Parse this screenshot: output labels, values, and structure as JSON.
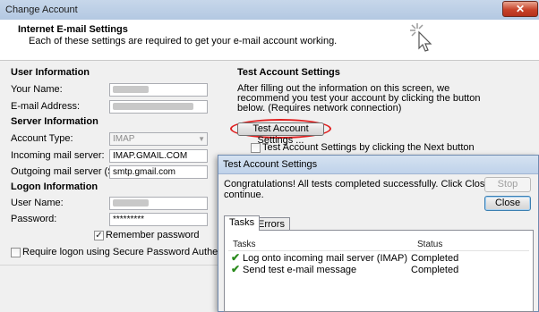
{
  "window": {
    "title": "Change Account",
    "close_label": "✕"
  },
  "header": {
    "title": "Internet E-mail Settings",
    "subtitle": "Each of these settings are required to get your e-mail account working."
  },
  "user_info": {
    "heading": "User Information",
    "name_label": "Your Name:",
    "email_label": "E-mail Address:"
  },
  "server_info": {
    "heading": "Server Information",
    "account_type_label": "Account Type:",
    "account_type_value": "IMAP",
    "incoming_label": "Incoming mail server:",
    "incoming_value": "IMAP.GMAIL.COM",
    "outgoing_label": "Outgoing mail server (SMTP):",
    "outgoing_value": "smtp.gmail.com"
  },
  "logon_info": {
    "heading": "Logon Information",
    "username_label": "User Name:",
    "password_label": "Password:",
    "password_value": "*********",
    "remember_label": "Remember password",
    "remember_checked": true,
    "spa_label": "Require logon using Secure Password Authentication (SPA)",
    "spa_checked": false
  },
  "test_settings": {
    "heading": "Test Account Settings",
    "description_line1": "After filling out the information on this screen, we",
    "description_line2": "recommend you test your account by clicking the button",
    "description_line3": "below. (Requires network connection)",
    "button_label": "Test Account Settings ...",
    "next_checkbox_label": "Test Account Settings by clicking the Next button",
    "highlight_color": "#e02020"
  },
  "dialog": {
    "title": "Test Account Settings",
    "message": "Congratulations! All tests completed successfully. Click Close to continue.",
    "stop_label": "Stop",
    "close_label": "Close",
    "tabs": [
      {
        "label": "Tasks"
      },
      {
        "label": "Errors"
      }
    ],
    "columns": {
      "tasks": "Tasks",
      "status": "Status"
    },
    "rows": [
      {
        "task": "Log onto incoming mail server (IMAP)",
        "status": "Completed"
      },
      {
        "task": "Send test e-mail message",
        "status": "Completed"
      }
    ],
    "check_icon": "✔"
  }
}
